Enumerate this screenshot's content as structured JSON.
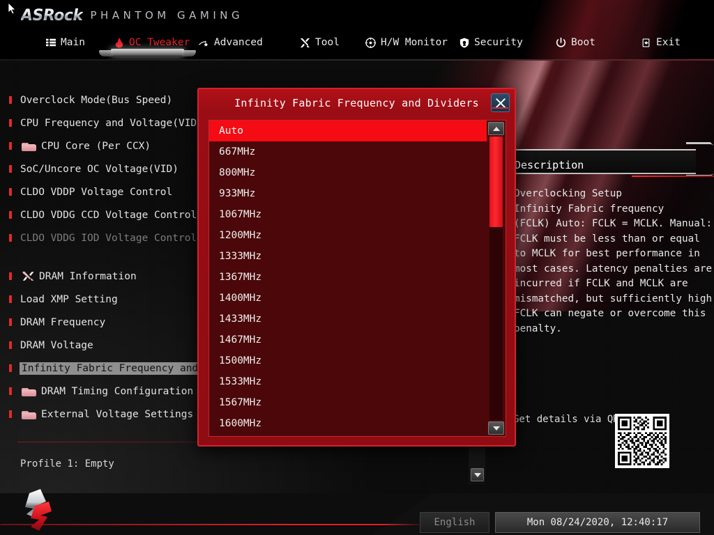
{
  "header": {
    "brand_primary": "ASRock",
    "brand_secondary": "PHANTOM GAMING",
    "tabs": [
      {
        "label": "Main",
        "icon": "list-icon",
        "active": false
      },
      {
        "label": "OC Tweaker",
        "icon": "flame-icon",
        "active": true
      },
      {
        "label": "Advanced",
        "icon": "star-icon",
        "active": false
      },
      {
        "label": "Tool",
        "icon": "tools-icon",
        "active": false
      },
      {
        "label": "H/W Monitor",
        "icon": "gauge-icon",
        "active": false
      },
      {
        "label": "Security",
        "icon": "shield-icon",
        "active": false
      },
      {
        "label": "Boot",
        "icon": "power-icon",
        "active": false
      },
      {
        "label": "Exit",
        "icon": "exit-icon",
        "active": false
      }
    ]
  },
  "sidebar": {
    "items": [
      {
        "label": "Overclock Mode(Bus Speed)",
        "folder": false,
        "wrench": false,
        "dim": false,
        "selected": false
      },
      {
        "label": "CPU Frequency and Voltage(VID) Change",
        "folder": false,
        "wrench": false,
        "dim": false,
        "selected": false
      },
      {
        "label": "CPU Core  (Per CCX)",
        "folder": true,
        "wrench": false,
        "dim": false,
        "selected": false
      },
      {
        "label": "SoC/Uncore OC Voltage(VID)",
        "folder": false,
        "wrench": false,
        "dim": false,
        "selected": false
      },
      {
        "label": "CLDO VDDP Voltage Control",
        "folder": false,
        "wrench": false,
        "dim": false,
        "selected": false
      },
      {
        "label": "CLDO VDDG CCD Voltage Control",
        "folder": false,
        "wrench": false,
        "dim": false,
        "selected": false
      },
      {
        "label": "CLDO VDDG IOD Voltage Control",
        "folder": false,
        "wrench": false,
        "dim": true,
        "selected": false
      }
    ],
    "items2": [
      {
        "label": "DRAM Information",
        "folder": false,
        "wrench": true,
        "dim": false,
        "selected": false
      },
      {
        "label": "Load XMP Setting",
        "folder": false,
        "wrench": false,
        "dim": false,
        "selected": false
      },
      {
        "label": "DRAM Frequency",
        "folder": false,
        "wrench": false,
        "dim": false,
        "selected": false
      },
      {
        "label": "DRAM Voltage",
        "folder": false,
        "wrench": false,
        "dim": false,
        "selected": false
      },
      {
        "label": "Infinity Fabric Frequency and Dividers",
        "folder": false,
        "wrench": false,
        "dim": false,
        "selected": true
      },
      {
        "label": "DRAM Timing Configuration",
        "folder": true,
        "wrench": false,
        "dim": true,
        "selected": false
      },
      {
        "label": "External Voltage Settings and Load-line Calibration",
        "folder": true,
        "wrench": false,
        "dim": false,
        "selected": false
      }
    ],
    "profile": "Profile 1: Empty"
  },
  "description": {
    "title": "Description",
    "body": "Overclocking Setup\nInfinity Fabric frequency\n(FCLK) Auto: FCLK = MCLK. Manual:\nFCLK must be less than or equal\nto MCLK for best performance in\nmost cases. Latency penalties are\nincurred if FCLK and MCLK are\nmismatched, but sufficiently high\nFCLK can negate or overcome this\npenalty.",
    "qr_label": "Get details via QR code"
  },
  "dialog": {
    "title": "Infinity Fabric Frequency and Dividers",
    "close_icon": "close-icon",
    "selected_option": "Auto",
    "options": [
      "Auto",
      "667MHz",
      "800MHz",
      "933MHz",
      "1067MHz",
      "1200MHz",
      "1333MHz",
      "1367MHz",
      "1400MHz",
      "1433MHz",
      "1467MHz",
      "1500MHz",
      "1533MHz",
      "1567MHz",
      "1600MHz"
    ],
    "scroll_up_icon": "caret-up-icon",
    "scroll_down_icon": "caret-down-icon"
  },
  "footer": {
    "language": "English",
    "datetime": "Mon 08/24/2020, 12:40:17"
  },
  "colors": {
    "accent_red": "#e02029",
    "dialog_red": "#9a0d14",
    "highlight_red": "#f50b13",
    "panel_dark": "#4b0709",
    "text_light": "#e8e8e8"
  }
}
